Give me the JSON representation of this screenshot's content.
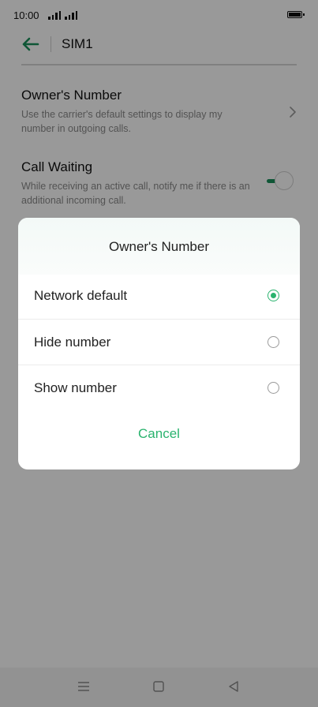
{
  "status_bar": {
    "time": "10:00"
  },
  "header": {
    "title": "SIM1"
  },
  "settings": [
    {
      "title": "Owner's Number",
      "description": "Use the carrier's default settings to display my number in outgoing calls."
    },
    {
      "title": "Call Waiting",
      "description": "While receiving an active call, notify me if there is an additional incoming call.",
      "toggle_on": true
    }
  ],
  "dialog": {
    "title": "Owner's Number",
    "options": [
      {
        "label": "Network default",
        "selected": true
      },
      {
        "label": "Hide number",
        "selected": false
      },
      {
        "label": "Show number",
        "selected": false
      }
    ],
    "cancel_label": "Cancel"
  },
  "colors": {
    "accent": "#2ab36e",
    "toggle": "#1a8f5a",
    "scrim": "rgba(0,0,0,0.40)"
  },
  "icons": [
    "back-arrow-icon",
    "chevron-right-icon",
    "signal-icon",
    "battery-icon",
    "menu-nav-icon",
    "home-nav-icon",
    "back-nav-icon"
  ]
}
